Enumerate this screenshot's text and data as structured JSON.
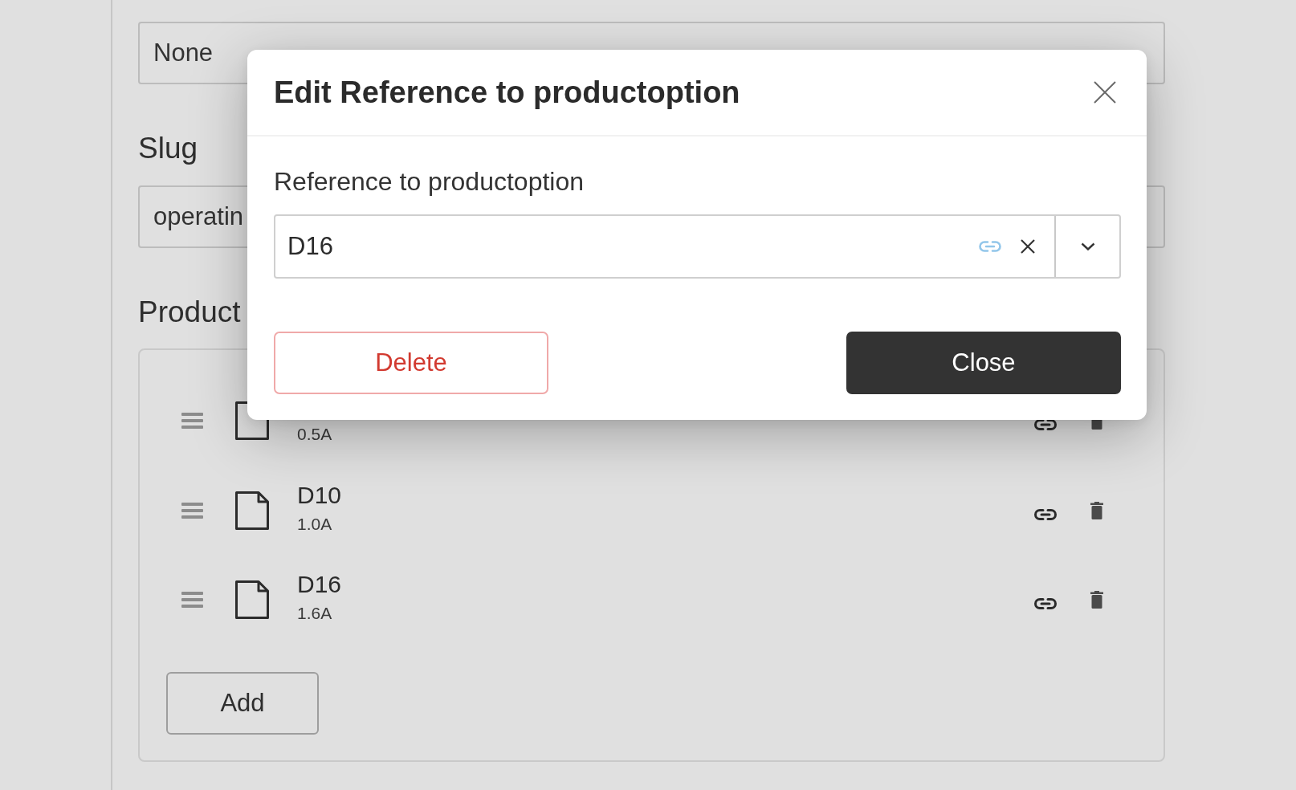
{
  "form": {
    "top_select": {
      "value": "None"
    },
    "slug": {
      "label": "Slug",
      "value": "operatin"
    },
    "products": {
      "heading": "Product",
      "items": [
        {
          "subtitle": "0.5A"
        },
        {
          "title": "D10",
          "subtitle": "1.0A"
        },
        {
          "title": "D16",
          "subtitle": "1.6A"
        }
      ],
      "add_button": "Add"
    }
  },
  "modal": {
    "title": "Edit Reference to productoption",
    "field_label": "Reference to productoption",
    "field_value": "D16",
    "buttons": [
      {
        "label": "Delete",
        "kind": "danger"
      },
      {
        "label": "Close",
        "kind": "primary"
      }
    ]
  }
}
